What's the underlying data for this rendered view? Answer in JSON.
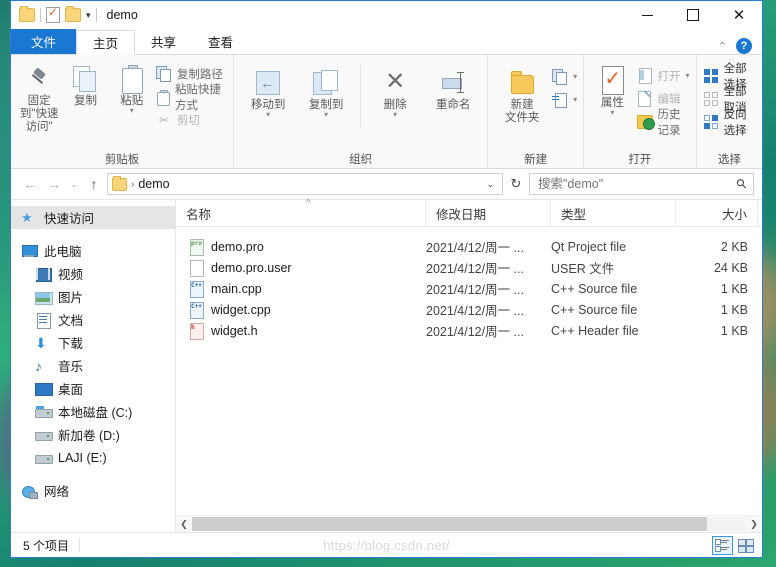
{
  "window": {
    "title": "demo",
    "quick_access": [
      "folder-icon",
      "properties-icon",
      "new-folder-icon",
      "customize-caret"
    ],
    "controls": {
      "minimize": "—",
      "maximize": "❐",
      "close": "✕"
    },
    "collapse_ribbon": "⌃",
    "help": "?"
  },
  "tabs": [
    {
      "label": "文件",
      "type": "file"
    },
    {
      "label": "主页",
      "type": "active"
    },
    {
      "label": "共享",
      "type": "normal"
    },
    {
      "label": "查看",
      "type": "normal"
    }
  ],
  "ribbon": {
    "groups": [
      {
        "name": "clipboard",
        "label": "剪贴板",
        "big_buttons": [
          {
            "label": "固定到\"快速访问\"",
            "icon": "pin-icon"
          },
          {
            "label": "复制",
            "icon": "copy-icon"
          },
          {
            "label": "粘贴",
            "icon": "paste-icon"
          }
        ],
        "small_buttons": [
          {
            "label": "复制路径",
            "icon": "copy-path-icon"
          },
          {
            "label": "粘贴快捷方式",
            "icon": "paste-shortcut-icon"
          },
          {
            "label": "剪切",
            "icon": "cut-icon"
          }
        ]
      },
      {
        "name": "organize",
        "label": "组织",
        "big_buttons": [
          {
            "label": "移动到",
            "icon": "move-to-icon"
          },
          {
            "label": "复制到",
            "icon": "copy-to-icon"
          },
          {
            "label": "删除",
            "icon": "delete-icon"
          },
          {
            "label": "重命名",
            "icon": "rename-icon"
          }
        ]
      },
      {
        "name": "new",
        "label": "新建",
        "big_buttons": [
          {
            "label": "新建\n文件夹",
            "label_line1": "新建",
            "label_line2": "文件夹",
            "icon": "new-folder-icon"
          }
        ],
        "small_buttons": [
          {
            "label": "",
            "icon": "new-item-icon"
          },
          {
            "label": "",
            "icon": "easy-access-icon"
          }
        ]
      },
      {
        "name": "open",
        "label": "打开",
        "big_buttons": [
          {
            "label": "属性",
            "icon": "properties-icon"
          }
        ],
        "small_buttons": [
          {
            "label": "打开",
            "icon": "open-icon"
          },
          {
            "label": "编辑",
            "icon": "edit-icon"
          },
          {
            "label": "历史记录",
            "icon": "history-icon"
          }
        ]
      },
      {
        "name": "select",
        "label": "选择",
        "small_buttons": [
          {
            "label": "全部选择",
            "icon": "select-all-icon"
          },
          {
            "label": "全部取消",
            "icon": "select-none-icon"
          },
          {
            "label": "反向选择",
            "icon": "invert-selection-icon"
          }
        ]
      }
    ]
  },
  "address": {
    "back": "←",
    "forward": "→",
    "recent": "⌄",
    "up": "↑",
    "breadcrumb_folder": "folder-icon",
    "breadcrumb_separator": "›",
    "breadcrumb_text": "demo",
    "dropdown_caret": "⌄",
    "refresh": "↻",
    "search_placeholder": "搜索\"demo\"",
    "search_value": "",
    "search_icon": "search-icon"
  },
  "sidebar": {
    "items": [
      {
        "label": "快速访问",
        "icon": "star-icon",
        "level": 0,
        "selected": true
      },
      {
        "label": "此电脑",
        "icon": "this-pc-icon",
        "level": 0,
        "selected": false
      },
      {
        "label": "视频",
        "icon": "videos-icon",
        "level": 1,
        "selected": false
      },
      {
        "label": "图片",
        "icon": "pictures-icon",
        "level": 1,
        "selected": false
      },
      {
        "label": "文档",
        "icon": "documents-icon",
        "level": 1,
        "selected": false
      },
      {
        "label": "下载",
        "icon": "downloads-icon",
        "level": 1,
        "selected": false
      },
      {
        "label": "音乐",
        "icon": "music-icon",
        "level": 1,
        "selected": false
      },
      {
        "label": "桌面",
        "icon": "desktop-icon",
        "level": 1,
        "selected": false
      },
      {
        "label": "本地磁盘 (C:)",
        "icon": "drive-icon",
        "level": 1,
        "selected": false
      },
      {
        "label": "新加卷 (D:)",
        "icon": "drive-icon",
        "level": 1,
        "selected": false
      },
      {
        "label": "LAJI (E:)",
        "icon": "drive-icon",
        "level": 1,
        "selected": false
      },
      {
        "label": "网络",
        "icon": "network-icon",
        "level": 0,
        "selected": false
      }
    ]
  },
  "filelist": {
    "columns": [
      {
        "label": "名称",
        "key": "name"
      },
      {
        "label": "修改日期",
        "key": "date"
      },
      {
        "label": "类型",
        "key": "type"
      },
      {
        "label": "大小",
        "key": "size"
      }
    ],
    "sort_indicator": "^",
    "rows": [
      {
        "name": "demo.pro",
        "date": "2021/4/12/周一 ...",
        "type": "Qt Project file",
        "size": "2 KB",
        "icon": "pro-file-icon",
        "icon_tag": "pro"
      },
      {
        "name": "demo.pro.user",
        "date": "2021/4/12/周一 ...",
        "type": "USER 文件",
        "size": "24 KB",
        "icon": "generic-file-icon",
        "icon_tag": ""
      },
      {
        "name": "main.cpp",
        "date": "2021/4/12/周一 ...",
        "type": "C++ Source file",
        "size": "1 KB",
        "icon": "cpp-file-icon",
        "icon_tag": "C++"
      },
      {
        "name": "widget.cpp",
        "date": "2021/4/12/周一 ...",
        "type": "C++ Source file",
        "size": "1 KB",
        "icon": "cpp-file-icon",
        "icon_tag": "C++"
      },
      {
        "name": "widget.h",
        "date": "2021/4/12/周一 ...",
        "type": "C++ Header file",
        "size": "1 KB",
        "icon": "h-file-icon",
        "icon_tag": "h"
      }
    ]
  },
  "statusbar": {
    "item_count": "5 个项目",
    "watermark": "https://blog.csdn.net/",
    "view_details_icon": "details-view-icon",
    "view_tiles_icon": "large-icons-view-icon"
  }
}
